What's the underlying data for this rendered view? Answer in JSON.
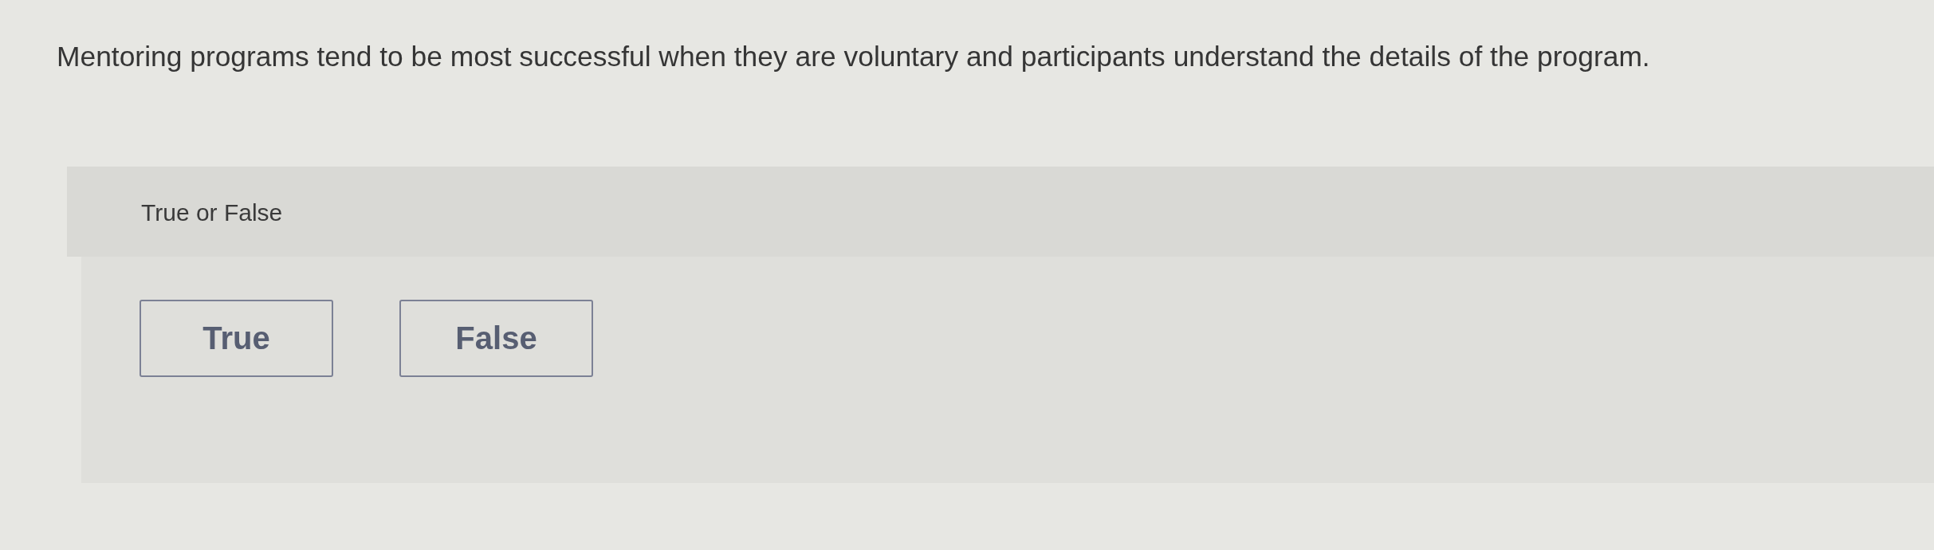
{
  "question": {
    "text": "Mentoring programs tend to be most successful when they are voluntary and participants understand the details of the program."
  },
  "answer_panel": {
    "prompt": "True or False",
    "options": [
      {
        "label": "True",
        "selected": false
      },
      {
        "label": "False",
        "selected": false
      }
    ]
  }
}
